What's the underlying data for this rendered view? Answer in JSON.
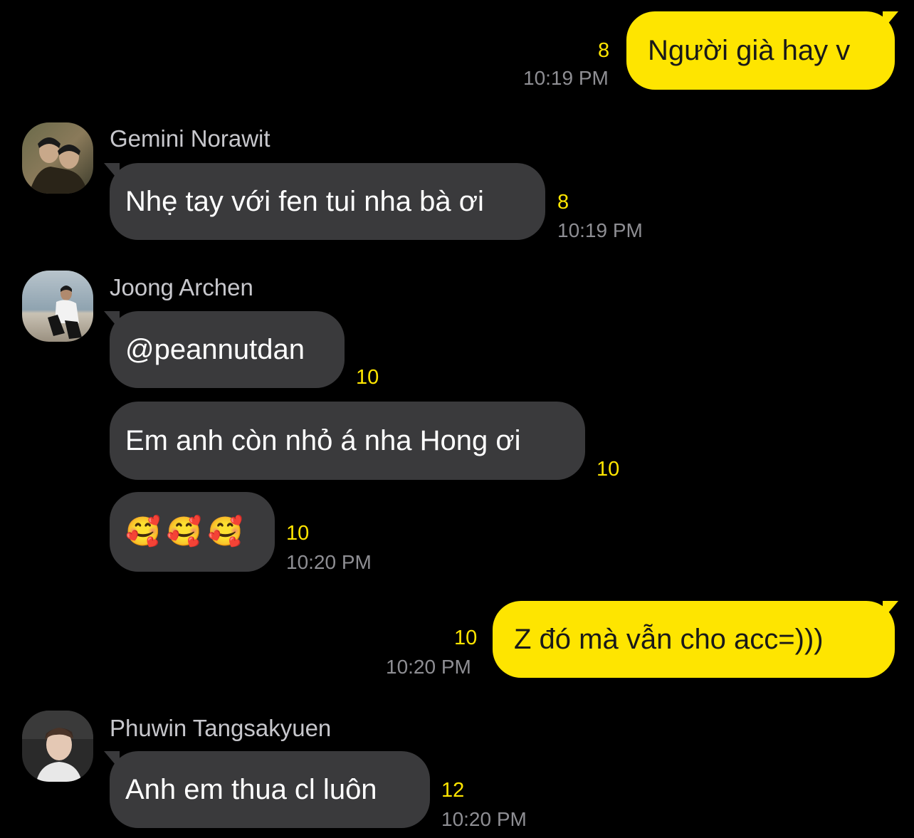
{
  "messages": {
    "m1": {
      "text": "Người già hay v",
      "unread": "8",
      "time": "10:19 PM"
    },
    "m2": {
      "sender": "Gemini Norawit",
      "text": "Nhẹ tay với fen tui nha bà ơi",
      "unread": "8",
      "time": "10:19 PM"
    },
    "m3": {
      "sender": "Joong Archen",
      "text": "@peannutdan",
      "unread": "10"
    },
    "m4": {
      "text": "Em anh còn nhỏ á nha Hong ơi",
      "unread": "10"
    },
    "m5": {
      "emojis": [
        "🥰",
        "🥰",
        "🥰"
      ],
      "unread": "10",
      "time": "10:20 PM"
    },
    "m6": {
      "text": "Z đó mà vẫn cho acc=)))",
      "unread": "10",
      "time": "10:20 PM"
    },
    "m7": {
      "sender": "Phuwin Tangsakyuen",
      "text": "Anh em thua cl luôn",
      "unread": "12",
      "time": "10:20 PM"
    }
  },
  "colors": {
    "background": "#000000",
    "outgoing_bubble": "#fee500",
    "incoming_bubble": "#3a3a3c",
    "unread_count": "#fee500",
    "timestamp": "#8e8e93"
  }
}
